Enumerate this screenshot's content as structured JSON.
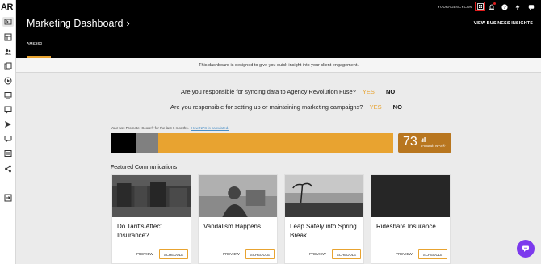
{
  "app": {
    "logo": "AR"
  },
  "header": {
    "title": "Marketing Dashboard",
    "title_chevron": "›",
    "agency": "YOURAGENCY.COM",
    "agency_chevron": "⌄",
    "view_insights": "VIEW BUSINESS INSIGHTS",
    "tabs": [
      {
        "label": "AMS360"
      }
    ],
    "icons": [
      "apps-icon",
      "notifications-icon",
      "help-icon",
      "bolt-icon",
      "chat-icon"
    ]
  },
  "banner": {
    "text": "This dashboard is designed to give you quick insight into your client engagement."
  },
  "questions": [
    {
      "text": "Are you responsible for syncing data to Agency Revolution Fuse?",
      "yes": "YES",
      "no": "NO"
    },
    {
      "text": "Are you responsible for setting up or maintaining marketing campaigns?",
      "yes": "YES",
      "no": "NO"
    }
  ],
  "nps": {
    "label": "Your Net Promoter Score® for the last 6 months.",
    "link": "How NPS is calculated.",
    "score": "73",
    "score_label": "6-Month NPS®",
    "segments": {
      "detractors": 0.089,
      "passives": 0.08,
      "promoters": 0.831
    },
    "colors": {
      "detractors": "#000000",
      "passives": "#808080",
      "promoters": "#e8a330",
      "score_bg": "#b8761f"
    }
  },
  "featured": {
    "heading": "Featured Communications",
    "cards": [
      {
        "title": "Do Tariffs Affect Insurance?",
        "preview": "PREVIEW",
        "schedule": "SCHEDULE"
      },
      {
        "title": "Vandalism Happens",
        "preview": "PREVIEW",
        "schedule": "SCHEDULE"
      },
      {
        "title": "Leap Safely into Spring Break",
        "preview": "PREVIEW",
        "schedule": "SCHEDULE"
      },
      {
        "title": "Rideshare Insurance",
        "preview": "PREVIEW",
        "schedule": "SCHEDULE"
      }
    ]
  },
  "sidebar": {
    "icons": [
      "collapse-icon",
      "dashboard-icon",
      "contacts-icon",
      "campaigns-icon",
      "media-icon",
      "screen-icon",
      "reviews-icon",
      "send-icon",
      "messages-icon",
      "forms-icon",
      "share-icon",
      "exit-icon"
    ]
  },
  "colors": {
    "accent": "#e8a330",
    "chat": "#7c3aed"
  }
}
